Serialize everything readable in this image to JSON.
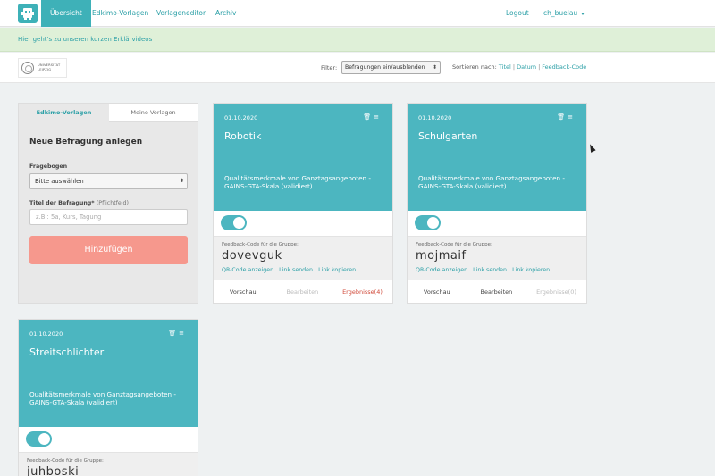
{
  "nav": {
    "items": [
      "Übersicht",
      "Edkimo-Vorlagen",
      "Vorlageneditor",
      "Archiv"
    ],
    "logout": "Logout",
    "user": "ch_buelau"
  },
  "banner": {
    "text": "Hier geht's zu unseren kurzen Erklärvideos"
  },
  "logo": {
    "org_line1": "UNIVERSITÄT",
    "org_line2": "LEIPZIG"
  },
  "filter": {
    "label": "Filter:",
    "value": "Befragungen ein/ausblenden",
    "sort_label": "Sortieren nach:",
    "sort_options": [
      "Titel",
      "Datum",
      "Feedback-Code"
    ]
  },
  "panel": {
    "tabs": [
      "Edkimo-Vorlagen",
      "Meine Vorlagen"
    ],
    "heading": "Neue Befragung anlegen",
    "questionnaire_label": "Fragebogen",
    "questionnaire_value": "Bitte auswählen",
    "title_label": "Titel der Befragung*",
    "title_hint": "(Pflichtfeld)",
    "title_placeholder": "z.B.: 5a, Kurs, Tagung",
    "add_button": "Hinzufügen"
  },
  "card_common": {
    "description": "Qualitätsmerkmale von Ganztagsangeboten - GAINS-GTA-Skala (validiert)",
    "code_label": "Feedback-Code für die Gruppe:",
    "links": [
      "QR-Code anzeigen",
      "Link senden",
      "Link kopieren"
    ],
    "actions": [
      "Vorschau",
      "Bearbeiten",
      "Ergebnisse(4)",
      "Ergebnisse(0)"
    ]
  },
  "cards": [
    {
      "date": "01.10.2020",
      "title": "Robotik",
      "code": "dovevguk",
      "active": true
    },
    {
      "date": "01.10.2020",
      "title": "Schulgarten",
      "code": "mojmaif",
      "active": true
    },
    {
      "date": "01.10.2020",
      "title": "Streitschlichter",
      "code": "juhboski",
      "active": true
    }
  ],
  "colors": {
    "accent": "#4cb6c0",
    "add_button": "#f6988d",
    "banner": "#dff0d8"
  }
}
